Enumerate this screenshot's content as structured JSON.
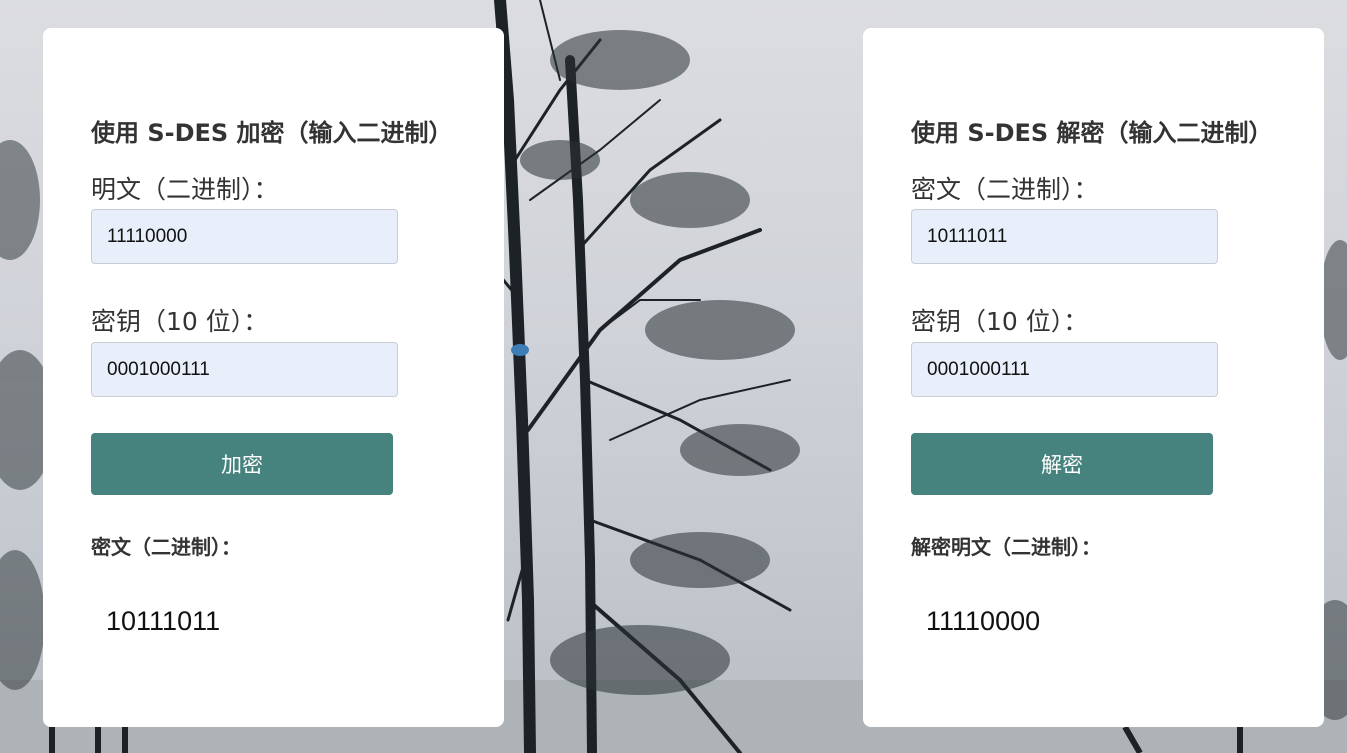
{
  "background": {
    "description_colors": {
      "sky": "#d5d7dc",
      "tree": "#1e2326"
    }
  },
  "encrypt": {
    "title": "使用 S-DES 加密（输入二进制）",
    "plaintext_label": "明文（二进制）：",
    "plaintext_value": "11110000",
    "key_label": "密钥（10 位）：",
    "key_value": "0001000111",
    "button_label": "加密",
    "result_label": "密文（二进制）：",
    "result_value": "10111011"
  },
  "decrypt": {
    "title": "使用 S-DES 解密（输入二进制）",
    "ciphertext_label": "密文（二进制）：",
    "ciphertext_value": "10111011",
    "key_label": "密钥（10 位）：",
    "key_value": "0001000111",
    "button_label": "解密",
    "result_label": "解密明文（二进制）：",
    "result_value": "11110000"
  },
  "colors": {
    "button": "#46837e",
    "input_bg": "#e8effb",
    "card_bg": "#ffffff"
  }
}
